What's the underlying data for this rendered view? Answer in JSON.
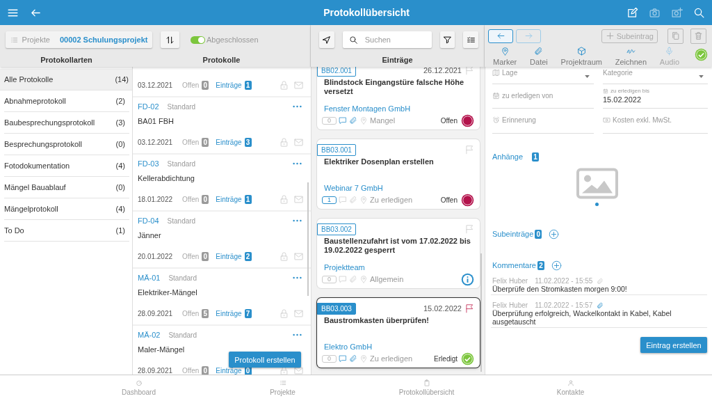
{
  "app_bar": {
    "title": "Protokollübersicht"
  },
  "project_bar": {
    "label": "Projekte",
    "project": "00002 Schulungsprojekt",
    "toggle": {
      "label": "Abgeschlossen",
      "on": true
    }
  },
  "columns": {
    "types": "Protokollarten",
    "protocols": "Protokolle",
    "entries": "Einträge"
  },
  "protocol_types": [
    {
      "name": "Alle Protokolle",
      "count": "(14)",
      "selected": true
    },
    {
      "name": "Abnahmeprotokoll",
      "count": "(2)",
      "selected": false
    },
    {
      "name": "Baubesprechungsprotokoll",
      "count": "(3)",
      "selected": false
    },
    {
      "name": "Besprechungsprotokoll",
      "count": "(0)",
      "selected": false
    },
    {
      "name": "Fotodokumentation",
      "count": "(4)",
      "selected": false
    },
    {
      "name": "Mängel Bauablauf",
      "count": "(0)",
      "selected": false
    },
    {
      "name": "Mängelprotokoll",
      "count": "(4)",
      "selected": false
    },
    {
      "name": "To Do",
      "count": "(1)",
      "selected": false
    }
  ],
  "protocols": [
    {
      "date": "03.12.2021",
      "open_label": "Offen",
      "open_count": "0",
      "entries_label": "Einträge",
      "entries_count": "1"
    },
    {
      "id": "FD-02",
      "type": "Standard",
      "title": "BA01 FBH",
      "date": "03.12.2021",
      "open_label": "Offen",
      "open_count": "0",
      "entries_label": "Einträge",
      "entries_count": "3"
    },
    {
      "id": "FD-03",
      "type": "Standard",
      "title": "Kellerabdichtung",
      "date": "18.01.2022",
      "open_label": "Offen",
      "open_count": "0",
      "entries_label": "Einträge",
      "entries_count": "1"
    },
    {
      "id": "FD-04",
      "type": "Standard",
      "title": "Jänner",
      "date": "20.01.2022",
      "open_label": "Offen",
      "open_count": "0",
      "entries_label": "Einträge",
      "entries_count": "2"
    },
    {
      "id": "MÄ-01",
      "type": "Standard",
      "title": "Elektriker-Mängel",
      "date": "28.09.2021",
      "open_label": "Offen",
      "open_count": "5",
      "entries_label": "Einträge",
      "entries_count": "7"
    },
    {
      "id": "MÄ-02",
      "type": "Standard",
      "title": "Maler-Mängel",
      "date": "28.09.2021",
      "open_label": "Offen",
      "open_count": "0",
      "entries_label": "Einträge",
      "entries_count": "0"
    }
  ],
  "create_protocol_button": "Protokoll erstellen",
  "search": {
    "placeholder": "Suchen"
  },
  "entries": [
    {
      "tag": "BB02.001",
      "date": "26.12.2021",
      "flagged": false,
      "title": "Blindstock Eingangstüre falsche Höhe versetzt",
      "company": "Fenster Montagen GmbH",
      "count": "0",
      "count_active": false,
      "comments": true,
      "attachments": true,
      "category": "Mangel",
      "status": "Offen",
      "kind": "open",
      "selected": false
    },
    {
      "tag": "BB03.001",
      "flagged": false,
      "title": "Elektriker Dosenplan erstellen",
      "company": "Webinar 7 GmbH",
      "count": "1",
      "count_active": true,
      "comments": false,
      "attachments": false,
      "category": "Zu erledigen",
      "status": "Offen",
      "kind": "open",
      "selected": false
    },
    {
      "tag": "BB03.002",
      "flagged": false,
      "title": "Baustellenzufahrt ist vom 17.02.2022 bis 19.02.2022 gesperrt",
      "company": "Projektteam",
      "count": "0",
      "count_active": false,
      "comments": false,
      "attachments": false,
      "category": "Allgemein",
      "kind": "info",
      "selected": false
    },
    {
      "tag": "BB03.003",
      "date": "15.02.2022",
      "flagged": true,
      "title": "Baustromkasten überprüfen!",
      "company": "Elektro GmbH",
      "count": "0",
      "count_active": false,
      "comments": true,
      "attachments": true,
      "category": "Zu erledigen",
      "status": "Erledigt",
      "kind": "done",
      "selected": true
    }
  ],
  "detail": {
    "subentry_button": "Subeintrag",
    "forward_disabled": true,
    "tools": [
      {
        "label": "Marker",
        "kind": "marker",
        "disabled": false
      },
      {
        "label": "Datei",
        "kind": "file",
        "disabled": false
      },
      {
        "label": "Projektraum",
        "kind": "cube",
        "disabled": false
      },
      {
        "label": "Zeichnen",
        "kind": "draw",
        "disabled": false
      },
      {
        "label": "Audio",
        "kind": "audio",
        "disabled": true
      }
    ],
    "done": true,
    "fields": [
      {
        "label": "Lage",
        "kind": "select"
      },
      {
        "label": "Kategorie",
        "kind": "select"
      },
      {
        "label": "zu erledigen von",
        "kind": "text"
      },
      {
        "label": "zu erledigen bis",
        "kind": "text",
        "value": "15.02.2022"
      },
      {
        "label": "Erinnerung",
        "kind": "text"
      },
      {
        "label": "Kosten exkl. MwSt.",
        "kind": "text"
      }
    ],
    "attachments": {
      "label": "Anhänge",
      "count": "1"
    },
    "subentries": {
      "label": "Subeinträge",
      "count": "0"
    },
    "comments": {
      "label": "Kommentare",
      "count": "2",
      "items": [
        {
          "author": "Felix Huber",
          "time": "11.02.2022 - 15:55",
          "attachment_active": false,
          "text": "Überprüfe den Stromkasten morgen 9:00!"
        },
        {
          "author": "Felix Huber",
          "time": "11.02.2022 - 15:57",
          "attachment_active": true,
          "text": "Überprüfung erfolgreich, Wackelkontakt in Kabel, Kabel ausgetauscht"
        }
      ]
    },
    "create_entry_button": "Eintrag erstellen"
  },
  "bottom_nav": [
    {
      "label": "Dashboard"
    },
    {
      "label": "Projekte"
    },
    {
      "label": "Protokollübersicht"
    },
    {
      "label": "Kontakte"
    }
  ]
}
